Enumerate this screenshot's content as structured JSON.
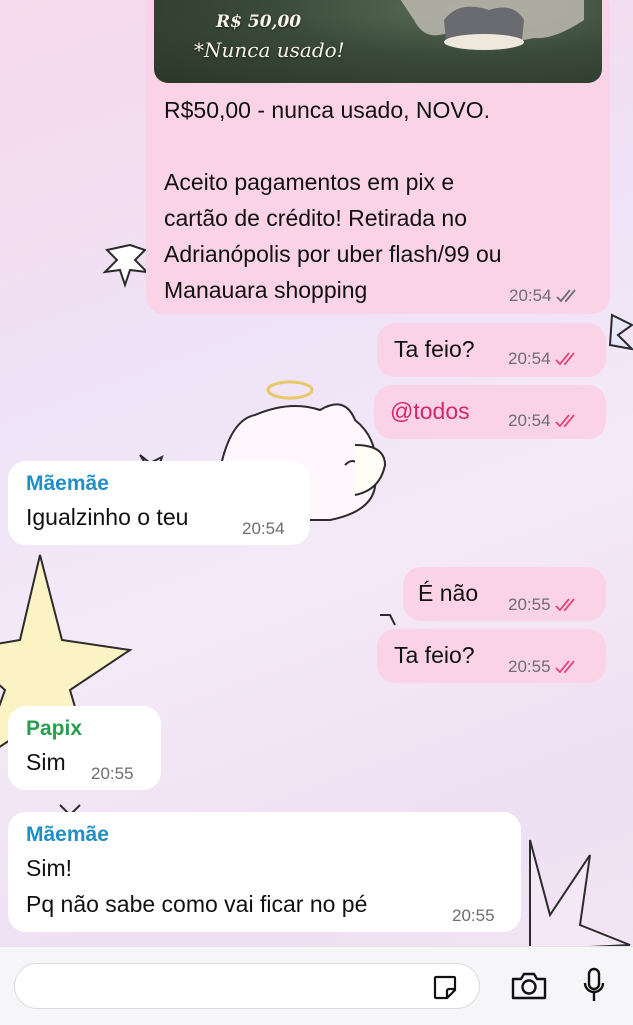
{
  "image_caption": {
    "price": "R$ 50,00",
    "note": "*Nunca usado!"
  },
  "messages": [
    {
      "id": "m1",
      "direction": "out",
      "lines": [
        "R$50,00 - nunca usado, NOVO.",
        "",
        "Aceito pagamentos em pix e",
        "cartão de crédito! Retirada no",
        "Adrianópolis por uber flash/99 ou",
        "Manauara shopping"
      ],
      "time": "20:54",
      "read": false
    },
    {
      "id": "m2",
      "direction": "out",
      "text": "Ta feio?",
      "time": "20:54",
      "read": true
    },
    {
      "id": "m3",
      "direction": "out",
      "mention": "@todos",
      "time": "20:54",
      "read": true
    },
    {
      "id": "m4",
      "direction": "in",
      "sender": "Mãemãe",
      "text": "Igualzinho o teu",
      "time": "20:54"
    },
    {
      "id": "m5",
      "direction": "out",
      "text": "É não",
      "time": "20:55",
      "read": true
    },
    {
      "id": "m6",
      "direction": "out",
      "text": "Ta feio?",
      "time": "20:55",
      "read": true
    },
    {
      "id": "m7",
      "direction": "in",
      "sender": "Papix",
      "text": "Sim",
      "time": "20:55"
    },
    {
      "id": "m8",
      "direction": "in",
      "sender": "Mãemãe",
      "lines": [
        "Sim!",
        "Pq não sabe como vai ficar no pé"
      ],
      "time": "20:55"
    }
  ],
  "colors": {
    "outgoing_bubble": "#fbd3e6",
    "incoming_bubble": "#ffffff",
    "sender_maemae": "#1f8fc4",
    "sender_papix": "#2a9d4f",
    "mention": "#d4266b",
    "read_check": "#e0457b",
    "unread_check": "#6d6d72"
  },
  "composer": {
    "placeholder": "",
    "icons": [
      "sticker-icon",
      "camera-icon",
      "microphone-icon"
    ]
  }
}
